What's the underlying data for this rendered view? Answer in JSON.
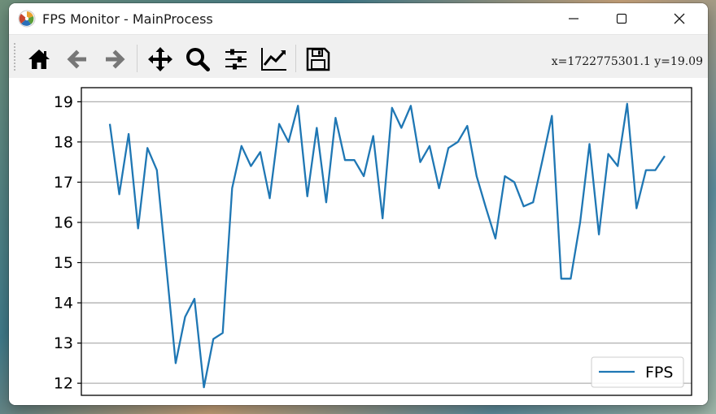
{
  "window": {
    "title": "FPS Monitor - MainProcess"
  },
  "toolbar": {
    "buttons": [
      {
        "name": "home-icon",
        "label": "Home"
      },
      {
        "name": "back-icon",
        "label": "Back"
      },
      {
        "name": "forward-icon",
        "label": "Forward"
      },
      {
        "name": "pan-icon",
        "label": "Pan"
      },
      {
        "name": "zoom-icon",
        "label": "Zoom"
      },
      {
        "name": "subplots-icon",
        "label": "Configure subplots"
      },
      {
        "name": "edit-axis-icon",
        "label": "Edit axis"
      },
      {
        "name": "save-icon",
        "label": "Save"
      }
    ],
    "coordinates": "x=1722775301.1  y=19.09"
  },
  "colors": {
    "line": "#1f77b4",
    "grid": "#b0b0b0"
  },
  "chart_data": {
    "type": "line",
    "ylim": [
      11.7,
      19.35
    ],
    "yticks": [
      12,
      13,
      14,
      15,
      16,
      17,
      18,
      19
    ],
    "grid": "horizontal",
    "legend_position": "lower-right",
    "series": [
      {
        "name": "FPS",
        "values": [
          18.45,
          16.7,
          18.2,
          15.85,
          17.85,
          17.3,
          14.9,
          12.5,
          13.65,
          14.1,
          11.9,
          13.1,
          13.25,
          16.85,
          17.9,
          17.4,
          17.75,
          16.6,
          18.45,
          18.0,
          18.9,
          16.65,
          18.35,
          16.5,
          18.6,
          17.55,
          17.55,
          17.15,
          18.15,
          16.1,
          18.85,
          18.35,
          18.9,
          17.5,
          17.9,
          16.85,
          17.85,
          18.0,
          18.4,
          17.15,
          16.35,
          15.6,
          17.15,
          17.0,
          16.4,
          16.5,
          17.55,
          18.65,
          14.6,
          14.6,
          16.0,
          17.95,
          15.7,
          17.7,
          17.4,
          18.95,
          16.35,
          17.3,
          17.3,
          17.65
        ]
      }
    ]
  }
}
